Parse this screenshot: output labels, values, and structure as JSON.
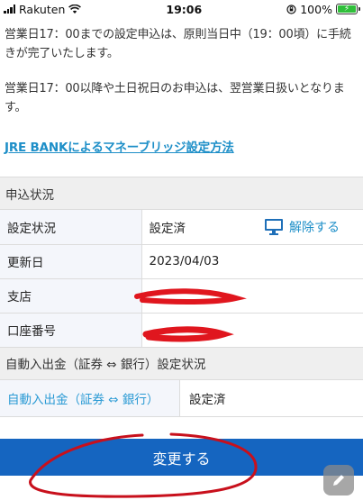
{
  "status_bar": {
    "carrier": "Rakuten",
    "time": "19:06",
    "battery": "100%",
    "icons": [
      "signal-icon",
      "wifi-icon",
      "rotation-lock-icon",
      "battery-charging-icon"
    ]
  },
  "notice": {
    "line1": "営業日17：00までの設定申込は、原則当日中（19：00頃）に手続きが完了いたします。",
    "line2": "営業日17：00以降や土日祝日のお申込は、翌営業日扱いとなります。"
  },
  "guide_link": "JRE BANKによるマネーブリッジ設定方法",
  "application_status": {
    "heading": "申込状況",
    "rows": [
      {
        "label": "設定状況",
        "value": "設定済",
        "action": "解除する"
      },
      {
        "label": "更新日",
        "value": "2023/04/03"
      },
      {
        "label": "支店",
        "value": ""
      },
      {
        "label": "口座番号",
        "value": ""
      }
    ]
  },
  "auto_transfer": {
    "heading": "自動入出金（証券 ⇔ 銀行）設定状況",
    "label": "自動入出金（証券 ⇔ 銀行）",
    "value": "設定済"
  },
  "change_button": "変更する",
  "colors": {
    "accent": "#1565c0",
    "link": "#1e8fc8",
    "redaction": "#e0161e",
    "battery": "#2fbf3a"
  }
}
